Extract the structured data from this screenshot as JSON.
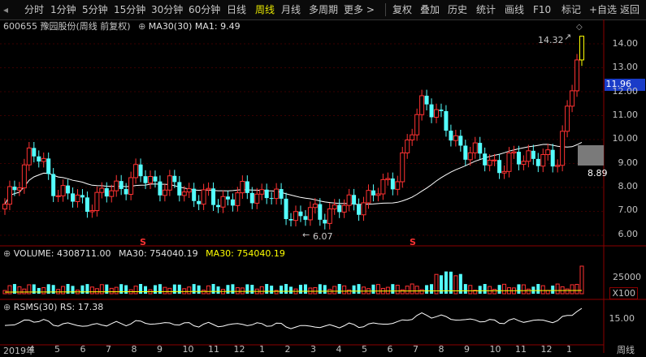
{
  "toolbar": {
    "left_icon": "panel-toggle-icon",
    "periods": [
      "分时",
      "1分钟",
      "5分钟",
      "15分钟",
      "30分钟",
      "60分钟",
      "日线",
      "周线",
      "月线",
      "多周期",
      "更多 >"
    ],
    "active_period": "周线",
    "right": [
      "复权",
      "叠加",
      "历史",
      "统计",
      "画线",
      "F10",
      "标记",
      "+自选",
      "返回"
    ]
  },
  "main_chart": {
    "title": "600655 豫园股份(周线 前复权)",
    "indicator": "MA30(30)  MA1: 9.49",
    "price_ticks": [
      "14.00",
      "13.00",
      "12.00",
      "11.00",
      "10.00",
      "9.00",
      "8.00",
      "7.00",
      "6.00"
    ],
    "current_price": "11.96",
    "last_close": "8.89",
    "annot_high": "14.32",
    "annot_low": "6.07",
    "s_marker": "S"
  },
  "volume_chart": {
    "title": "VOLUME: 4308711.00",
    "ma30_label_a": "MA30: 754040.19",
    "ma30_label_b": "MA30: 754040.19",
    "tick": "25000",
    "unit": "X100"
  },
  "rsms_chart": {
    "title": "RSMS(30)  RS: 17.38",
    "tick": "15.00"
  },
  "time_axis": {
    "labels": [
      "2019年",
      "4",
      "5",
      "6",
      "7",
      "8",
      "9",
      "10",
      "11",
      "12",
      "1",
      "2",
      "3",
      "4",
      "5",
      "6",
      "7",
      "8",
      "9",
      "10",
      "11",
      "12",
      "1"
    ],
    "period_label": "周线"
  },
  "colors": {
    "up": "#ff3232",
    "down": "#54ffff",
    "ma": "#ffffff",
    "highlight": "#ffff00",
    "grid": "#8b0000"
  },
  "chart_data": {
    "type": "candlestick",
    "title": "600655 豫园股份(周线 前复权)",
    "x": [
      "2019-03",
      "2019-04",
      "2019-05",
      "2019-06",
      "2019-07",
      "2019-08",
      "2019-09",
      "2019-10",
      "2019-11",
      "2019-12",
      "2020-01",
      "2020-02",
      "2020-03",
      "2020-04",
      "2020-05",
      "2020-06",
      "2020-07",
      "2020-08",
      "2020-09",
      "2020-10",
      "2020-11",
      "2020-12",
      "2021-01"
    ],
    "close_approx": [
      7.1,
      9.6,
      7.9,
      7.3,
      7.8,
      8.5,
      8.1,
      7.8,
      7.4,
      7.7,
      7.8,
      6.8,
      6.9,
      7.2,
      7.6,
      8.6,
      11.9,
      10.1,
      9.3,
      8.9,
      9.4,
      8.9,
      14.32
    ],
    "ylim": [
      6.0,
      14.5
    ],
    "ma30_last": 9.49,
    "volume_last": 4308711.0,
    "volume_ma30": 754040.19,
    "rs_last": 17.38
  }
}
